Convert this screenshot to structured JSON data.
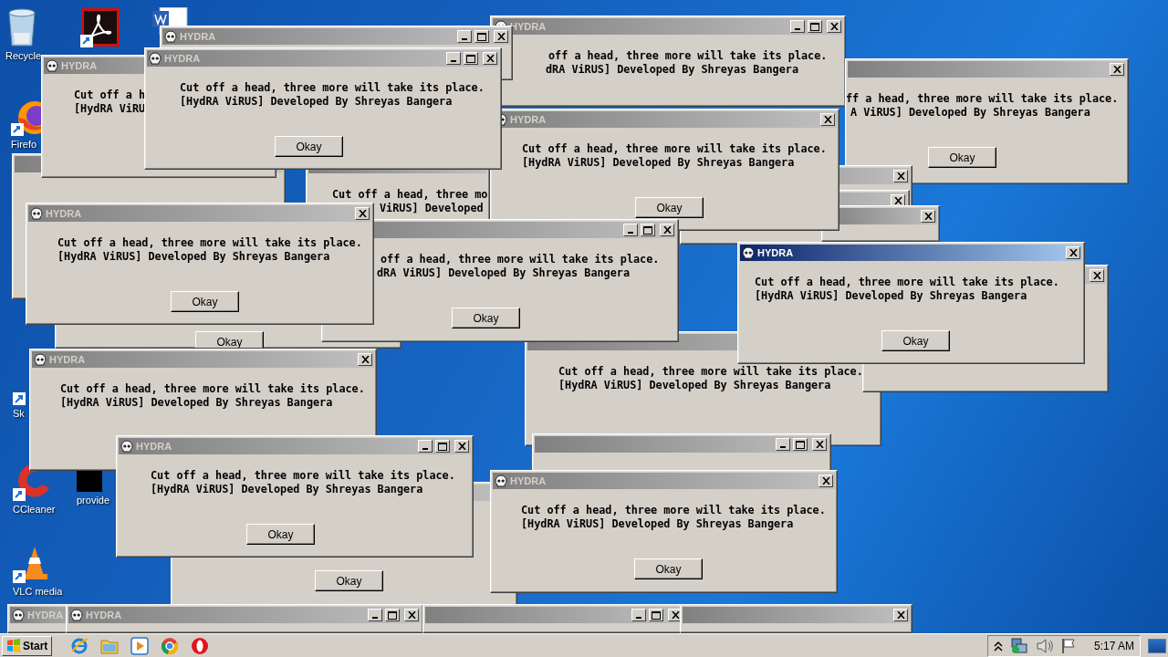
{
  "desktop_icons": [
    {
      "kind": "recycle",
      "label": "Recycle"
    },
    {
      "kind": "pdf"
    },
    {
      "kind": "word"
    },
    {
      "kind": "firefox",
      "label": "Firefo"
    },
    {
      "kind": "shortcut",
      "label": "Sk"
    },
    {
      "kind": "ccleaner",
      "label": "CCleaner"
    },
    {
      "kind": "app",
      "label": "provide"
    },
    {
      "kind": "vlc",
      "label": "VLC media"
    }
  ],
  "windows": [
    {
      "title": "HYDRA",
      "active": false,
      "kind": "full",
      "lines": [
        "off a head, three more will take its place.",
        "dRA ViRUS] Developed By Shreyas Bangera"
      ]
    },
    {
      "title": "HYDRA",
      "active": false,
      "kind": "full"
    },
    {
      "active": false,
      "kind": "close",
      "lines": [
        "ff a head, three more will take its place.",
        "A ViRUS] Developed By Shreyas Bangera"
      ],
      "button": "Okay"
    },
    {
      "active": false,
      "kind": "bare"
    },
    {
      "title": "HYDRA",
      "active": false,
      "kind": "bare",
      "lines": [
        "Cut off a h",
        "[HydRA ViRU"
      ]
    },
    {
      "kind": "bare",
      "lines": [
        "Cut off a head, three mo",
        "ViRUS] Developed"
      ]
    },
    {
      "active": false,
      "kind": "close"
    },
    {
      "active": false,
      "kind": "close"
    },
    {
      "active": false,
      "kind": "close"
    },
    {
      "kind": "body",
      "button": "Okay"
    },
    {
      "active": false,
      "kind": "bare",
      "lines": [
        "Cut off a head, three more will take its place.",
        "[HydRA ViRUS] Developed By Shreyas Bangera"
      ]
    },
    {
      "active": false,
      "kind": "close"
    },
    {
      "active": false,
      "kind": "bare",
      "button": "Okay"
    },
    {
      "active": false,
      "kind": "full"
    },
    {
      "title": "HYDRA",
      "active": false,
      "kind": "bare"
    },
    {
      "title": "HYDRA",
      "active": false,
      "kind": "full"
    },
    {
      "active": false,
      "kind": "full"
    },
    {
      "active": false,
      "kind": "close"
    },
    {
      "title": "HYDRA",
      "active": false,
      "kind": "close",
      "lines": [
        "Cut off a head, three more will take its place.",
        "[HydRA ViRUS] Developed By Shreyas Bangera"
      ],
      "button": "Okay"
    },
    {
      "active": false,
      "kind": "full",
      "lines": [
        "off a head, three more will take its place.",
        "dRA ViRUS] Developed By Shreyas Bangera"
      ],
      "button": "Okay"
    },
    {
      "title": "HYDRA",
      "active": false,
      "kind": "close",
      "lines": [
        "Cut off a head, three more will take its place.",
        "[HydRA ViRUS] Developed By Shreyas Bangera"
      ],
      "button": "Okay"
    },
    {
      "title": "HYDRA",
      "active": false,
      "kind": "full",
      "lines": [
        "Cut off a head, three more will take its place.",
        "[HydRA ViRUS] Developed By Shreyas Bangera"
      ],
      "button": "Okay"
    },
    {
      "title": "HYDRA",
      "active": true,
      "kind": "close",
      "lines": [
        "Cut off a head, three more will take its place.",
        "[HydRA ViRUS] Developed By Shreyas Bangera"
      ],
      "button": "Okay"
    },
    {
      "title": "HYDRA",
      "active": false,
      "kind": "close",
      "lines": [
        "Cut off a head, three more will take its place.",
        "[HydRA ViRUS] Developed By Shreyas Bangera"
      ]
    },
    {
      "title": "HYDRA",
      "active": false,
      "kind": "full",
      "lines": [
        "Cut off a head, three more will take its place.",
        "[HydRA ViRUS] Developed By Shreyas Bangera"
      ],
      "button": "Okay"
    },
    {
      "title": "HYDRA",
      "active": false,
      "kind": "close",
      "lines": [
        "Cut off a head, three more will take its place.",
        "[HydRA ViRUS] Developed By Shreyas Bangera"
      ],
      "button": "Okay"
    }
  ],
  "taskbar": {
    "start_label": "Start",
    "quick_launch": [
      {
        "kind": "ie"
      },
      {
        "kind": "folder"
      },
      {
        "kind": "media"
      },
      {
        "kind": "chrome"
      },
      {
        "kind": "opera"
      }
    ],
    "tray": [
      {
        "kind": "chevron"
      },
      {
        "kind": "network"
      },
      {
        "kind": "volume"
      },
      {
        "kind": "flag"
      }
    ],
    "clock": "5:17 AM"
  }
}
